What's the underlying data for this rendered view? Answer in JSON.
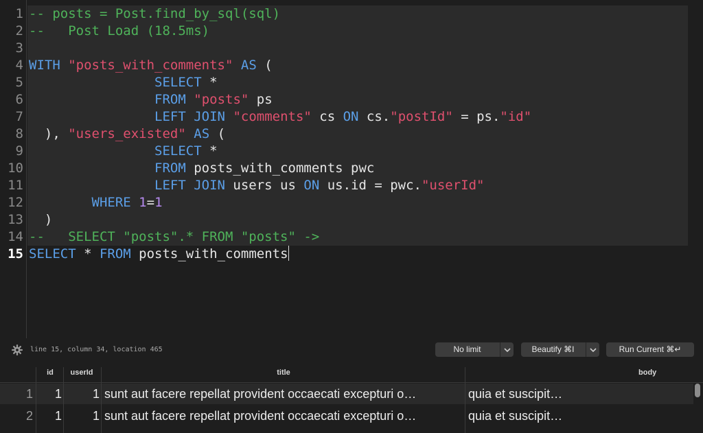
{
  "editor": {
    "line_numbers": [
      "1",
      "2",
      "3",
      "4",
      "5",
      "6",
      "7",
      "8",
      "9",
      "10",
      "11",
      "12",
      "13",
      "14",
      "15"
    ],
    "lines": [
      [
        [
          "comment",
          "-- posts = Post.find_by_sql(sql)"
        ]
      ],
      [
        [
          "comment",
          "--   Post Load (18.5ms)"
        ]
      ],
      [],
      [
        [
          "kw",
          "WITH"
        ],
        [
          "plain",
          " "
        ],
        [
          "str",
          "\"posts_with_comments\""
        ],
        [
          "plain",
          " "
        ],
        [
          "kw",
          "AS"
        ],
        [
          "plain",
          " ("
        ]
      ],
      [
        [
          "plain",
          "                "
        ],
        [
          "kw",
          "SELECT"
        ],
        [
          "plain",
          " *"
        ]
      ],
      [
        [
          "plain",
          "                "
        ],
        [
          "kw",
          "FROM"
        ],
        [
          "plain",
          " "
        ],
        [
          "str",
          "\"posts\""
        ],
        [
          "plain",
          " ps"
        ]
      ],
      [
        [
          "plain",
          "                "
        ],
        [
          "kw",
          "LEFT JOIN"
        ],
        [
          "plain",
          " "
        ],
        [
          "str",
          "\"comments\""
        ],
        [
          "plain",
          " cs "
        ],
        [
          "kw",
          "ON"
        ],
        [
          "plain",
          " cs."
        ],
        [
          "str",
          "\"postId\""
        ],
        [
          "plain",
          " = ps."
        ],
        [
          "str",
          "\"id\""
        ]
      ],
      [
        [
          "plain",
          "  ), "
        ],
        [
          "str",
          "\"users_existed\""
        ],
        [
          "plain",
          " "
        ],
        [
          "kw",
          "AS"
        ],
        [
          "plain",
          " ("
        ]
      ],
      [
        [
          "plain",
          "                "
        ],
        [
          "kw",
          "SELECT"
        ],
        [
          "plain",
          " *"
        ]
      ],
      [
        [
          "plain",
          "                "
        ],
        [
          "kw",
          "FROM"
        ],
        [
          "plain",
          " posts_with_comments pwc"
        ]
      ],
      [
        [
          "plain",
          "                "
        ],
        [
          "kw",
          "LEFT JOIN"
        ],
        [
          "plain",
          " users us "
        ],
        [
          "kw",
          "ON"
        ],
        [
          "plain",
          " us.id = pwc."
        ],
        [
          "str",
          "\"userId\""
        ]
      ],
      [
        [
          "plain",
          "        "
        ],
        [
          "kw",
          "WHERE"
        ],
        [
          "plain",
          " "
        ],
        [
          "num",
          "1"
        ],
        [
          "plain",
          "="
        ],
        [
          "num",
          "1"
        ]
      ],
      [
        [
          "plain",
          "  )"
        ]
      ],
      [
        [
          "comment",
          "--   SELECT \"posts\".* FROM \"posts\" ->"
        ]
      ],
      [
        [
          "kw",
          "SELECT"
        ],
        [
          "plain",
          " * "
        ],
        [
          "kw",
          "FROM"
        ],
        [
          "plain",
          " posts_with_comments"
        ]
      ]
    ],
    "current_line": 15
  },
  "status": {
    "position_text": "line 15, column 34, location 465",
    "limit_label": "No limit",
    "beautify_label": "Beautify ⌘I",
    "run_label": "Run Current ⌘↵",
    "settings_icon": "gear-icon",
    "chevron_icon": "chevron-down-icon"
  },
  "results": {
    "columns": [
      "id",
      "userId",
      "title",
      "body"
    ],
    "rows": [
      {
        "row_number": "1",
        "cells": [
          "1",
          "1",
          "sunt aut facere repellat provident occaecati excepturi o…",
          "quia et suscipit…"
        ]
      },
      {
        "row_number": "2",
        "cells": [
          "1",
          "1",
          "sunt aut facere repellat provident occaecati excepturi o…",
          "quia et suscipit…"
        ]
      }
    ]
  },
  "colors": {
    "background": "#1e1e1e",
    "comment": "#4fb35a",
    "keyword": "#5b9fe8",
    "string": "#e0506e",
    "number": "#b78bf0"
  }
}
